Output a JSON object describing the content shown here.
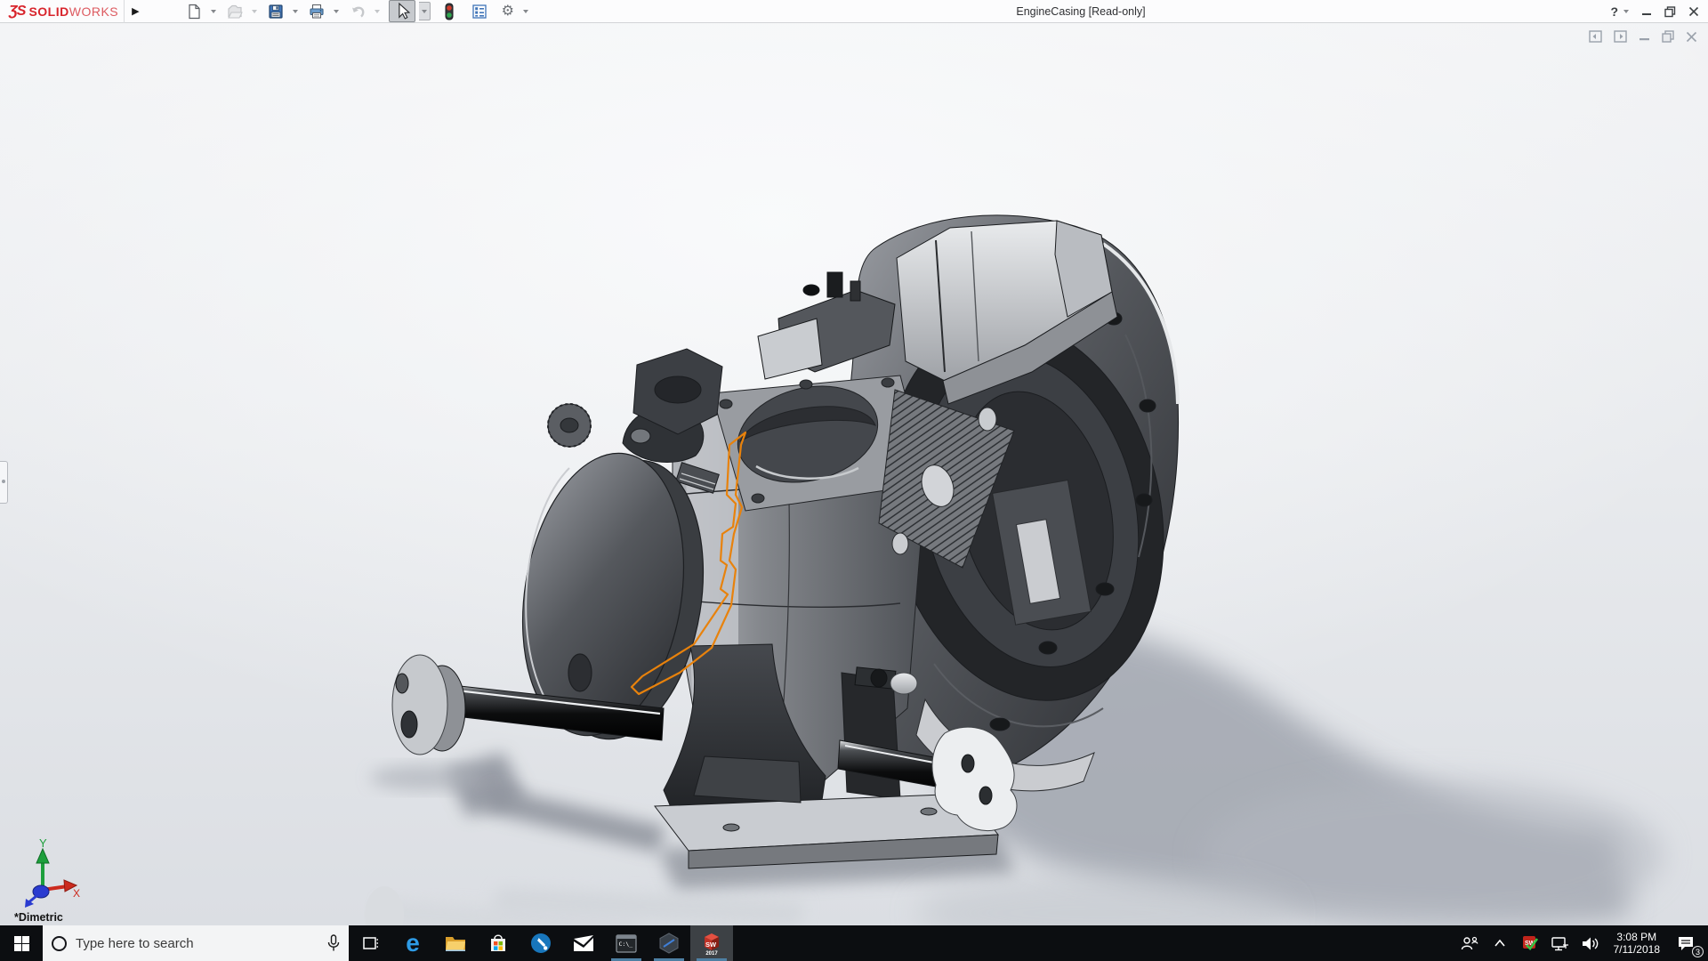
{
  "app": {
    "logo_glyph": "ƷS",
    "logo_solid": "SOLID",
    "logo_works": "WORKS",
    "menu_expand_arrow": "▶",
    "document_title": "EngineCasing [Read-only]",
    "help_label": "?"
  },
  "toolbar": {
    "items": [
      {
        "name": "new-document",
        "dropdown": true,
        "enabled": true
      },
      {
        "name": "open",
        "dropdown": true,
        "enabled": false
      },
      {
        "name": "save",
        "dropdown": true,
        "enabled": true
      },
      {
        "name": "print",
        "dropdown": true,
        "enabled": true
      },
      {
        "name": "undo",
        "dropdown": true,
        "enabled": false
      },
      {
        "name": "select",
        "dropdown": true,
        "enabled": true,
        "active": true
      },
      {
        "name": "rebuild-traffic-light",
        "dropdown": false,
        "enabled": true
      },
      {
        "name": "file-properties",
        "dropdown": false,
        "enabled": true
      },
      {
        "name": "options-gear",
        "dropdown": true,
        "enabled": true
      }
    ]
  },
  "viewport": {
    "view_orientation_label": "*Dimetric",
    "triad": {
      "x_label": "X",
      "y_label": "Y"
    },
    "colors": {
      "background_top": "#f2f3f5",
      "background_bottom": "#dbdee3",
      "sketch_highlight": "#e8820c",
      "triad_x": "#cc2a1e",
      "triad_y": "#1d9f3c",
      "triad_z": "#2a3bd0"
    }
  },
  "taskbar": {
    "search_placeholder": "Type here to search",
    "edge_letter": "e",
    "cmd_text": "C:\\_",
    "solidworks_icon": {
      "letters": "SW",
      "year": "2017"
    },
    "clock": {
      "time": "3:08 PM",
      "date": "7/11/2018"
    },
    "notification_count": "3",
    "accent_underline": "#4d7fa3"
  }
}
